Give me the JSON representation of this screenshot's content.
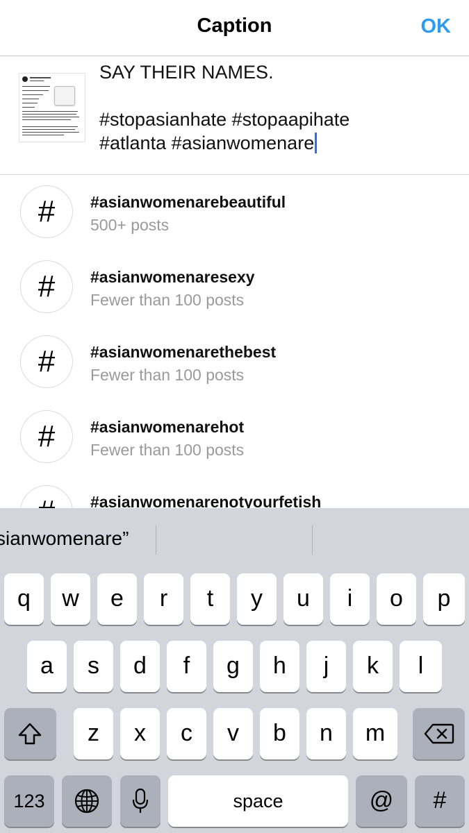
{
  "header": {
    "title": "Caption",
    "ok_label": "OK"
  },
  "caption": {
    "line1": "SAY THEIR NAMES.",
    "line2": "#stopasianhate #stopaapihate",
    "line3": "#atlanta #asianwomenare"
  },
  "suggestions": [
    {
      "tag": "#asianwomenarebeautiful",
      "count": "500+ posts"
    },
    {
      "tag": "#asianwomenaresexy",
      "count": "Fewer than 100 posts"
    },
    {
      "tag": "#asianwomenarethebest",
      "count": "Fewer than 100 posts"
    },
    {
      "tag": "#asianwomenarehot",
      "count": "Fewer than 100 posts"
    },
    {
      "tag": "#asianwomenarenotyourfetish",
      "count": ""
    }
  ],
  "suggestion_icon_glyph": "#",
  "keyboard": {
    "prediction": "sianwomenare”",
    "row1": [
      "q",
      "w",
      "e",
      "r",
      "t",
      "y",
      "u",
      "i",
      "o",
      "p"
    ],
    "row2": [
      "a",
      "s",
      "d",
      "f",
      "g",
      "h",
      "j",
      "k",
      "l"
    ],
    "row3": [
      "z",
      "x",
      "c",
      "v",
      "b",
      "n",
      "m"
    ],
    "numbers_label": "123",
    "space_label": "space",
    "at_label": "@",
    "hash_label": "#"
  },
  "icons": [
    "shift-icon",
    "backspace-icon",
    "globe-icon",
    "microphone-icon"
  ],
  "colors": {
    "accent": "#2c9cf2",
    "cursor": "#2f6cf6",
    "keyboard_bg": "#d2d5db",
    "muted_text": "#9a9a9a"
  }
}
